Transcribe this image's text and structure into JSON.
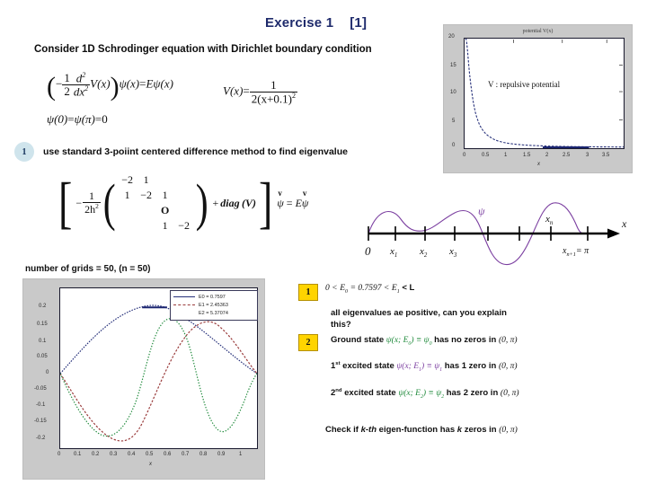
{
  "slide": {
    "title": "Exercise 1",
    "title_ref": "[1]",
    "lead": "Consider 1D Schrodinger equation with Dirichlet boundary condition"
  },
  "equations": {
    "schrodinger_lhs_1": "−",
    "schrodinger": "(−1/2 d²/dx² + V(x))ψ(x) = Eψ(x)",
    "potential_def": "V(x) = 1 / (2(x+0.1)²)",
    "boundary": "ψ(0) = ψ(π) = 0",
    "half": "1",
    "two": "2",
    "d2": "d",
    "dx2": "dx",
    "V": "V",
    "x": "x",
    "psi": "ψ",
    "E": "E",
    "pi": "π",
    "zero": "0",
    "one": "1",
    "denom_potential": "2(x+0.1)",
    "numer_potential": "1",
    "h2_coeff": "2h",
    "diag": "diag",
    "matrix_rows": [
      [
        "−2",
        "1",
        "",
        "",
        ""
      ],
      [
        "1",
        "−2",
        "1",
        "",
        ""
      ],
      [
        "",
        "",
        "O",
        "",
        ""
      ],
      [
        "",
        "",
        "1",
        "−2",
        ""
      ]
    ],
    "matrix_center_symbol": "O"
  },
  "bullets": {
    "circle_1_number": "1",
    "circle_1_text": "use standard 3-poiint centered difference method to find eigenvalue"
  },
  "grids_label": "number of grids = 50, (n = 50)",
  "chart_data": [
    {
      "type": "line",
      "id": "potential-plot",
      "title": "potential V(x)",
      "xlabel": "x",
      "ylabel": "",
      "xlim": [
        0,
        3.5
      ],
      "ylim": [
        0,
        20
      ],
      "xticks": [
        "0",
        "0.5",
        "1",
        "1.5",
        "2",
        "2.5",
        "3",
        "3.5"
      ],
      "yticks": [
        "0",
        "5",
        "10",
        "15",
        "20"
      ],
      "grid": false,
      "annotation": "V : repulsive potential",
      "series": [
        {
          "name": "V(x) = 1/(2(x+0.1)^2)",
          "color": "#26307a",
          "x": [
            0.0,
            0.05,
            0.1,
            0.15,
            0.2,
            0.3,
            0.4,
            0.5,
            0.6,
            0.8,
            1.0,
            1.25,
            1.5,
            2.0,
            2.5,
            3.0,
            3.5
          ],
          "y": [
            50.0,
            22.2,
            12.5,
            8.0,
            5.56,
            3.13,
            2.0,
            1.39,
            1.02,
            0.617,
            0.413,
            0.272,
            0.195,
            0.113,
            0.074,
            0.052,
            0.039
          ]
        }
      ]
    },
    {
      "type": "line",
      "id": "eigenfunctions-plot",
      "title": "",
      "xlabel": "x",
      "ylabel": "",
      "xlim": [
        0,
        1
      ],
      "ylim": [
        -0.2,
        0.2
      ],
      "xticks": [
        "0",
        "0.1",
        "0.2",
        "0.3",
        "0.4",
        "0.5",
        "0.6",
        "0.7",
        "0.8",
        "0.9",
        "1"
      ],
      "yticks": [
        "0.2",
        "0.15",
        "0.1",
        "0.05",
        "0",
        "-0.05",
        "-0.1",
        "-0.15",
        "-0.2"
      ],
      "grid": false,
      "legend_position": "upper-right",
      "legend": [
        {
          "label": "E0 =   0.7597",
          "color": "#26307a",
          "style": "solid"
        },
        {
          "label": "E1 =   2.45363",
          "color": "#9a3b3b",
          "style": "dashed"
        },
        {
          "label": "E2 =  5.37074",
          "color": "#1f8a3b",
          "style": "dotted"
        }
      ],
      "series": [
        {
          "name": "ground state (n=1)",
          "color": "#26307a",
          "zeros": 0
        },
        {
          "name": "1st excited state (n=2)",
          "color": "#9a3b3b",
          "zeros": 1
        },
        {
          "name": "2nd excited state (n=3)",
          "color": "#1f8a3b",
          "zeros": 2
        }
      ]
    }
  ],
  "grid_diagram": {
    "axis_label": "x",
    "wave_label": "ψ",
    "ticks": [
      "0",
      "x₁",
      "x₂",
      "x₃",
      "xₙ"
    ],
    "tick_0": "0",
    "tick_1": "x",
    "tick_1_sub": "1",
    "tick_2": "x",
    "tick_2_sub": "2",
    "tick_3": "x",
    "tick_3_sub": "3",
    "tick_n": "x",
    "tick_n_sub": "n",
    "tick_end": "x",
    "tick_end_sub": "n+1",
    "tick_end_value": "= π"
  },
  "notes": {
    "badge_1": "1",
    "badge_2": "2",
    "eigen_inequality_pre": "0 <",
    "eigen_E0": "E",
    "eigen_E0_sub": "0",
    "eigen_value": "= 0.7597 <",
    "eigen_E1": "E",
    "eigen_E1_sub": "1",
    "eigen_post": "< L",
    "question_line1": "all eigenvalues ae positive, can you explain",
    "question_line2": "this?",
    "ground_state_label": "Ground state",
    "ground_state_math": "ψ(x; E",
    "ground_state_sub": "0",
    "ground_state_math2": ") ≡ ψ",
    "ground_state_sub2": "0",
    "ground_state_tail": "has no zeros in",
    "interval": "(0, π)",
    "excited1_label": "1",
    "excited1_sup": "st",
    "excited1_label2": "excited state",
    "excited1_math": "ψ(x; E",
    "excited1_sub": "1",
    "excited1_math2": ") ≡ ψ",
    "excited1_sub2": "1",
    "excited1_tail": "has 1 zero in",
    "excited2_label": "2",
    "excited2_sup": "nd",
    "excited2_label2": "excited state",
    "excited2_math": "ψ(x; E",
    "excited2_sub": "2",
    "excited2_math2": ") ≡ ψ",
    "excited2_sub2": "2",
    "excited2_tail": "has 2 zero in",
    "check_line_pre": "Check if",
    "check_line_k": "k-th",
    "check_line_mid": "eigen-function has",
    "check_line_k2": "k",
    "check_line_post": "zeros in"
  },
  "colors": {
    "title": "#1f2b6c",
    "badge_blue": "#cfe4ec",
    "badge_yellow": "#ffd400",
    "series_ground": "#26307a",
    "series_first": "#9a3b3b",
    "series_second": "#1f8a3b",
    "wave": "#7b3fa0",
    "figure_bg": "#c9c9c9"
  }
}
